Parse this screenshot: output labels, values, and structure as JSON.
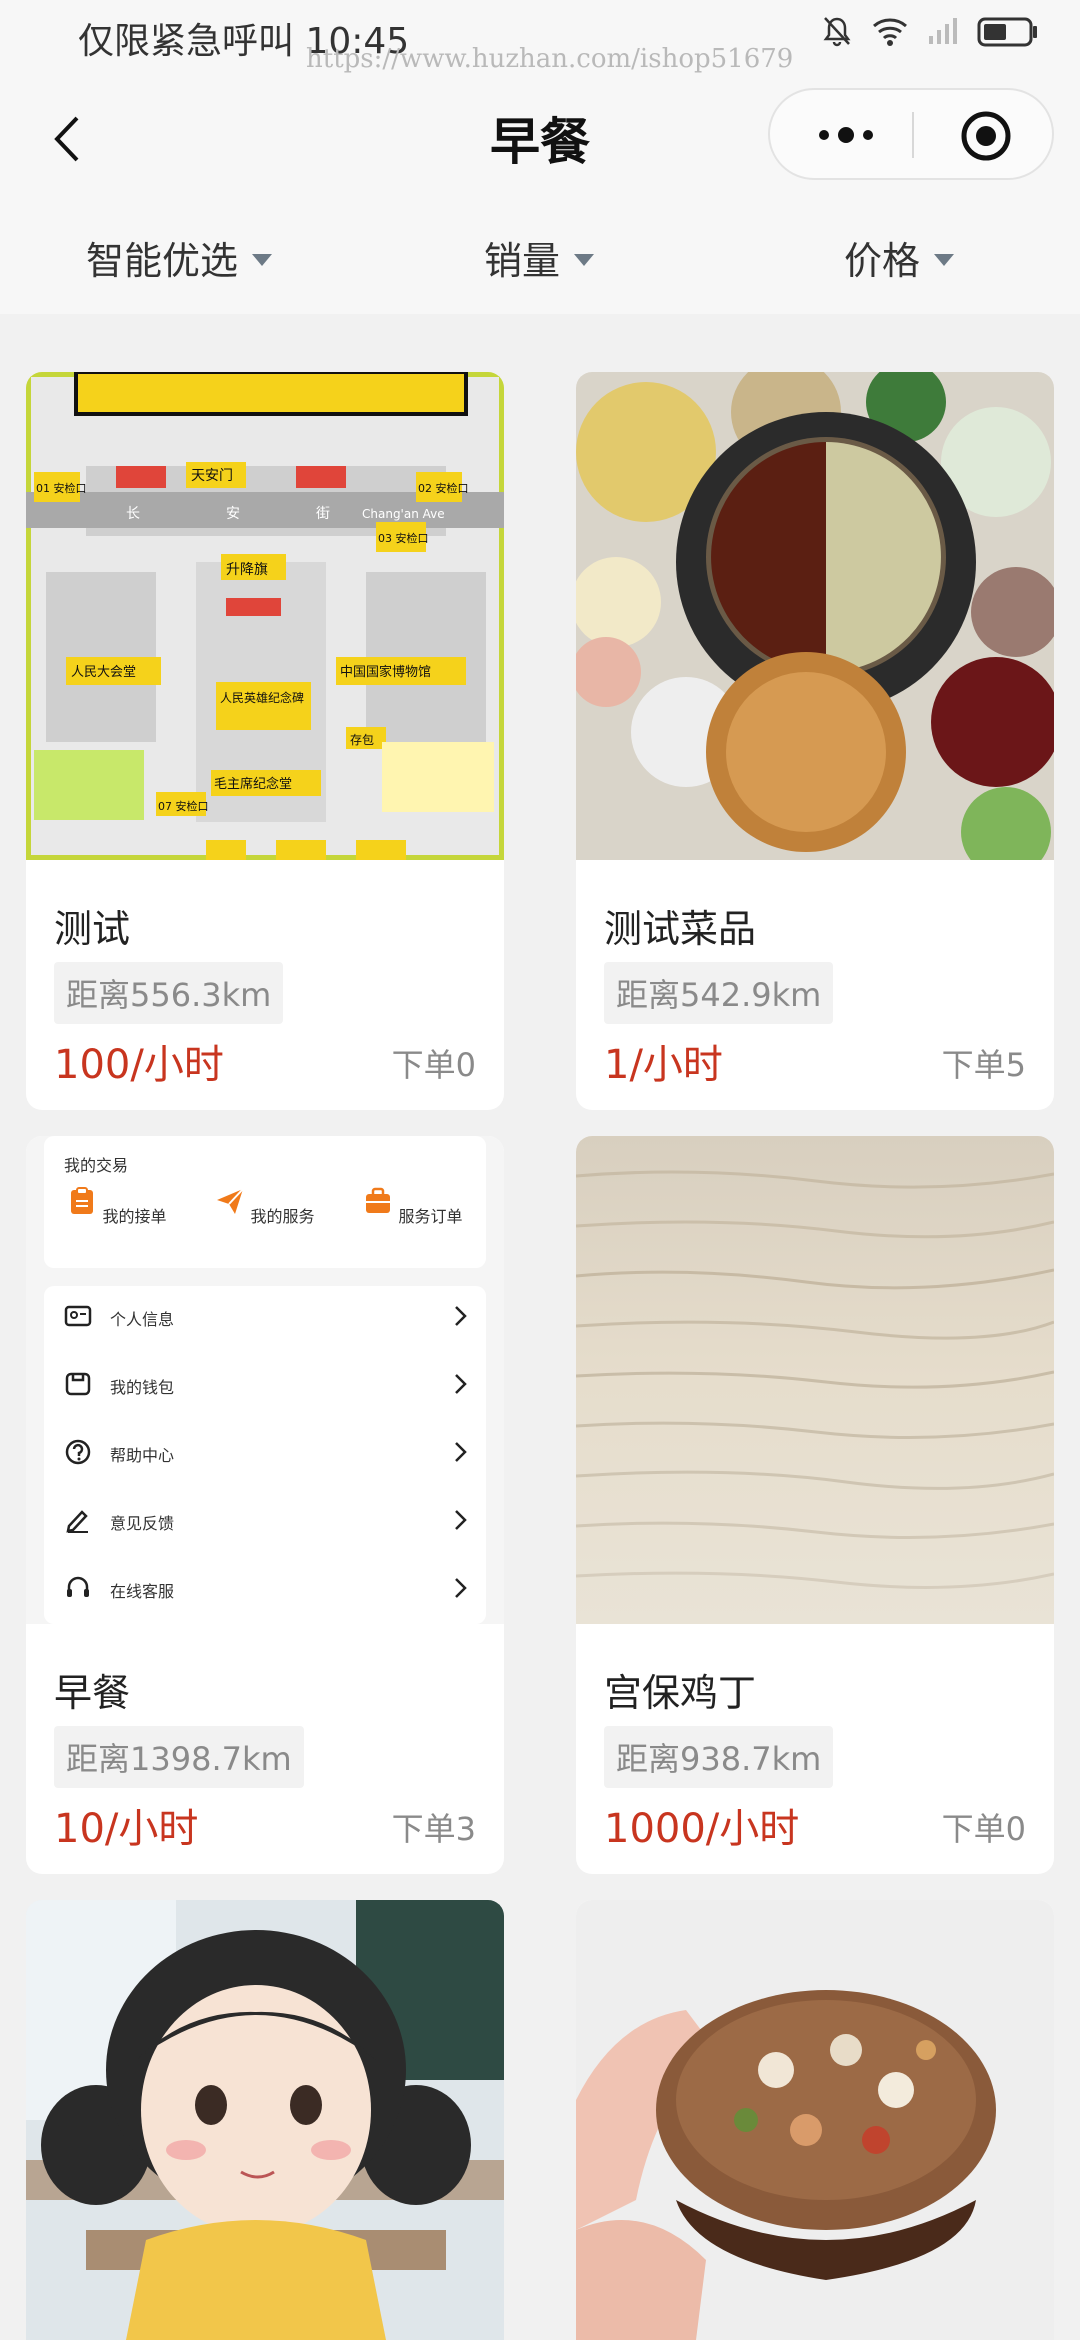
{
  "status_bar": {
    "left_text": "仅限紧急呼叫 10:45",
    "watermark": "https://www.huzhan.com/ishop51679",
    "icons": [
      "mute-bell-icon",
      "wifi-icon",
      "signal-icon",
      "battery-icon"
    ]
  },
  "nav": {
    "title": "早餐",
    "back_icon": "chevron-left-icon",
    "more_icon": "more-dots-icon",
    "close_icon": "target-icon"
  },
  "filters": [
    {
      "label": "智能优选",
      "icon": "caret-down-icon"
    },
    {
      "label": "销量",
      "icon": "caret-down-icon"
    },
    {
      "label": "价格",
      "icon": "caret-down-icon"
    }
  ],
  "items": [
    {
      "title": "测试",
      "distance": "距离556.3km",
      "price": "100/小时",
      "orders": "下单0"
    },
    {
      "title": "测试菜品",
      "distance": "距离542.9km",
      "price": "1/小时",
      "orders": "下单5"
    },
    {
      "title": "早餐",
      "distance": "距离1398.7km",
      "price": "10/小时",
      "orders": "下单3"
    },
    {
      "title": "宫保鸡丁",
      "distance": "距离938.7km",
      "price": "1000/小时",
      "orders": "下单0"
    }
  ],
  "image_text": {
    "map": {
      "labels": [
        "天安门",
        "升降旗",
        "人民大会堂",
        "中国国家博物馆",
        "人民英雄纪念碑",
        "毛主席纪念堂",
        "存包",
        "长",
        "安",
        "街",
        "Chang'an Ave",
        "01 安检口",
        "02 安检口",
        "03 安检口",
        "07 安检口"
      ]
    },
    "profile": {
      "section_title": "我的交易",
      "buttons": [
        "我的接单",
        "我的服务",
        "服务订单"
      ],
      "rows": [
        "个人信息",
        "我的钱包",
        "帮助中心",
        "意见反馈",
        "在线客服"
      ]
    }
  },
  "colors": {
    "price": "#c8351f",
    "accent_orange": "#f07a1a",
    "map_yellow": "#f5d21b"
  }
}
